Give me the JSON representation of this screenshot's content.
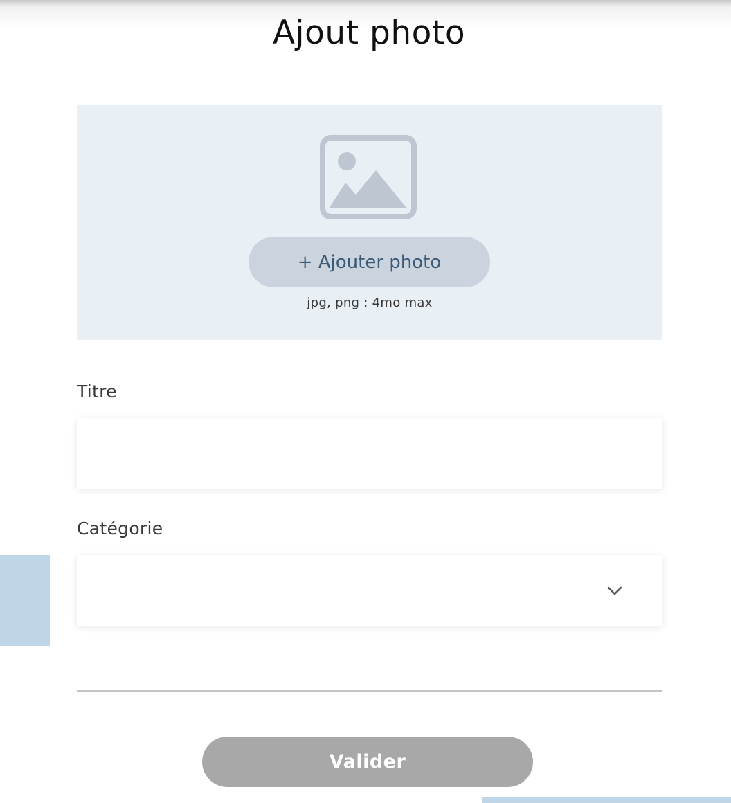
{
  "header": {
    "title": "Ajout photo"
  },
  "upload": {
    "icon": "image-placeholder-icon",
    "button_label": "+ Ajouter photo",
    "hint": "jpg, png : 4mo max",
    "zone_color": "#e8eff5",
    "button_color": "#cbd4de",
    "button_text_color": "#3b5a77"
  },
  "form": {
    "title_label": "Titre",
    "title_value": "",
    "category_label": "Catégorie",
    "category_value": "",
    "category_icon": "chevron-down-icon"
  },
  "actions": {
    "submit_label": "Valider",
    "submit_color": "#a8a8a8"
  },
  "decor": {
    "accent_color": "#bed6e7"
  }
}
